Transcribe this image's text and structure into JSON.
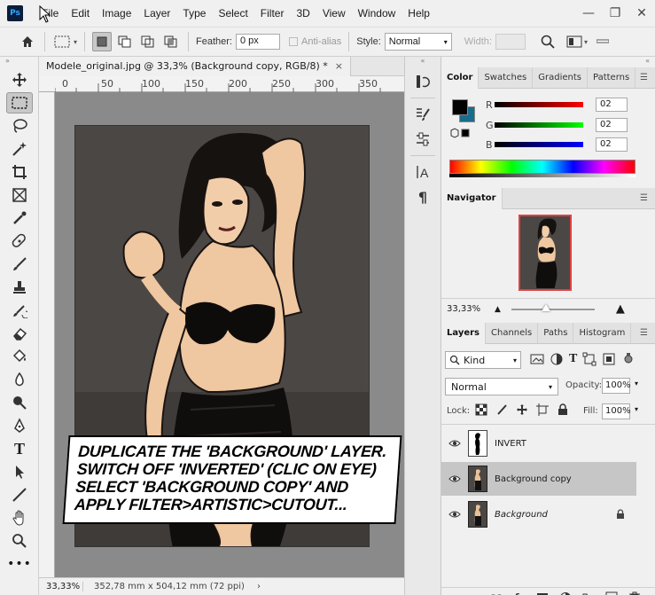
{
  "menubar": {
    "logo": "Ps",
    "items": [
      "File",
      "Edit",
      "Image",
      "Layer",
      "Type",
      "Select",
      "Filter",
      "3D",
      "View",
      "Window",
      "Help"
    ],
    "controls": {
      "minimize": "—",
      "restore": "❐",
      "close": "✕"
    }
  },
  "options": {
    "feather_label": "Feather:",
    "feather_value": "0 px",
    "antialias_label": "Anti-alias",
    "style_label": "Style:",
    "style_value": "Normal",
    "width_label": "Width:"
  },
  "document": {
    "tab_title": "Modele_original.jpg @ 33,3% (Background copy, RGB/8) *",
    "tab_close": "×",
    "ruler_ticks": [
      "0",
      "50",
      "100",
      "150",
      "200",
      "250",
      "300",
      "350"
    ],
    "caption_lines": [
      "DUPLICATE THE 'BACKGROUND' LAYER.",
      "SWITCH OFF 'INVERTED' (CLIC ON EYE)",
      "SELECT 'BACKGROUND COPY' AND",
      "APPLY FILTER>ARTISTIC>CUTOUT..."
    ],
    "zoom": "33,33%",
    "dimensions": "352,78 mm x 504,12 mm (72 ppi)",
    "status_arrow": "›"
  },
  "color_panel": {
    "tabs": [
      "Color",
      "Swatches",
      "Gradients",
      "Patterns"
    ],
    "channels": [
      {
        "label": "R",
        "value": "02",
        "color": "#ff0000"
      },
      {
        "label": "G",
        "value": "02",
        "color": "#00ff00"
      },
      {
        "label": "B",
        "value": "02",
        "color": "#0000ff"
      }
    ],
    "foreground": "#020202",
    "background": "#1a6d8a"
  },
  "navigator_panel": {
    "title": "Navigator",
    "zoom": "33,33%"
  },
  "layers_panel": {
    "tabs": [
      "Layers",
      "Channels",
      "Paths",
      "Histogram"
    ],
    "filter_label": "Kind",
    "blend_mode": "Normal",
    "opacity_label": "Opacity:",
    "opacity_value": "100%",
    "lock_label": "Lock:",
    "fill_label": "Fill:",
    "fill_value": "100%",
    "layers": [
      {
        "name": "INVERT"
      },
      {
        "name": "Background copy"
      },
      {
        "name": "Background"
      }
    ],
    "footer_icons": [
      "link-icon",
      "fx-icon",
      "mask-icon",
      "adjustment-icon",
      "group-icon",
      "new-layer-icon",
      "trash-icon"
    ],
    "fx_label": "fx"
  }
}
